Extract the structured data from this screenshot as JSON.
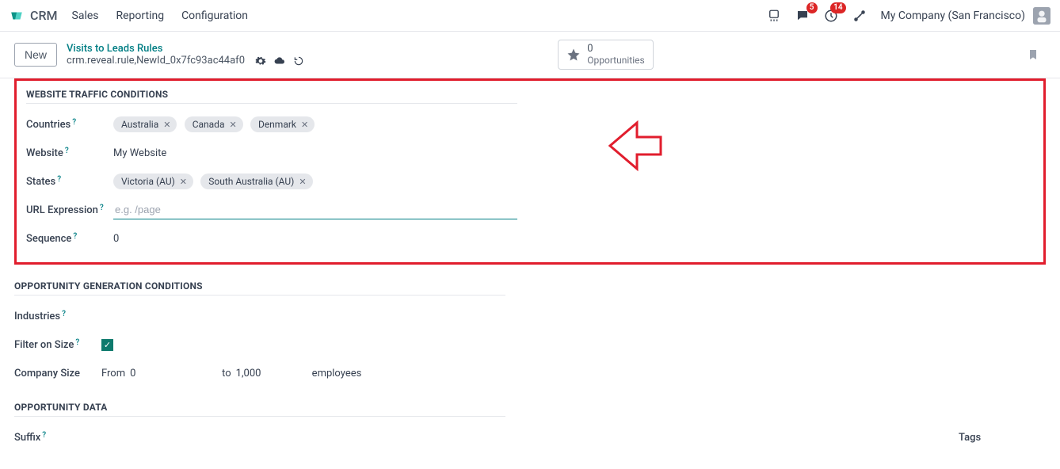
{
  "topbar": {
    "app_name": "CRM",
    "menu": [
      "Sales",
      "Reporting",
      "Configuration"
    ],
    "badge_messages": "5",
    "badge_activities": "14",
    "company_label": "My Company (San Francisco)"
  },
  "subbar": {
    "new_button": "New",
    "breadcrumb_title": "Visits to Leads Rules",
    "breadcrumb_record": "crm.reveal.rule,NewId_0x7fc93ac44af0",
    "stat_value": "0",
    "stat_label": "Opportunities"
  },
  "section_traffic": {
    "title": "WEBSITE TRAFFIC CONDITIONS",
    "labels": {
      "countries": "Countries",
      "website": "Website",
      "states": "States",
      "url_expression": "URL Expression",
      "sequence": "Sequence"
    },
    "countries": [
      "Australia",
      "Canada",
      "Denmark"
    ],
    "website_value": "My Website",
    "states": [
      "Victoria (AU)",
      "South Australia (AU)"
    ],
    "url_expression_placeholder": "e.g. /page",
    "url_expression_value": "",
    "sequence_value": "0"
  },
  "section_opportunity": {
    "title": "OPPORTUNITY GENERATION CONDITIONS",
    "labels": {
      "industries": "Industries",
      "filter_on_size": "Filter on Size",
      "company_size": "Company Size"
    },
    "filter_on_size_checked": true,
    "company_size": {
      "from_label": "From",
      "from_value": "0",
      "to_label": "to",
      "to_value": "1,000",
      "employees_label": "employees"
    }
  },
  "section_data": {
    "title": "OPPORTUNITY DATA",
    "labels": {
      "suffix": "Suffix",
      "tags": "Tags"
    }
  },
  "annotation_color": "#e11d2d"
}
